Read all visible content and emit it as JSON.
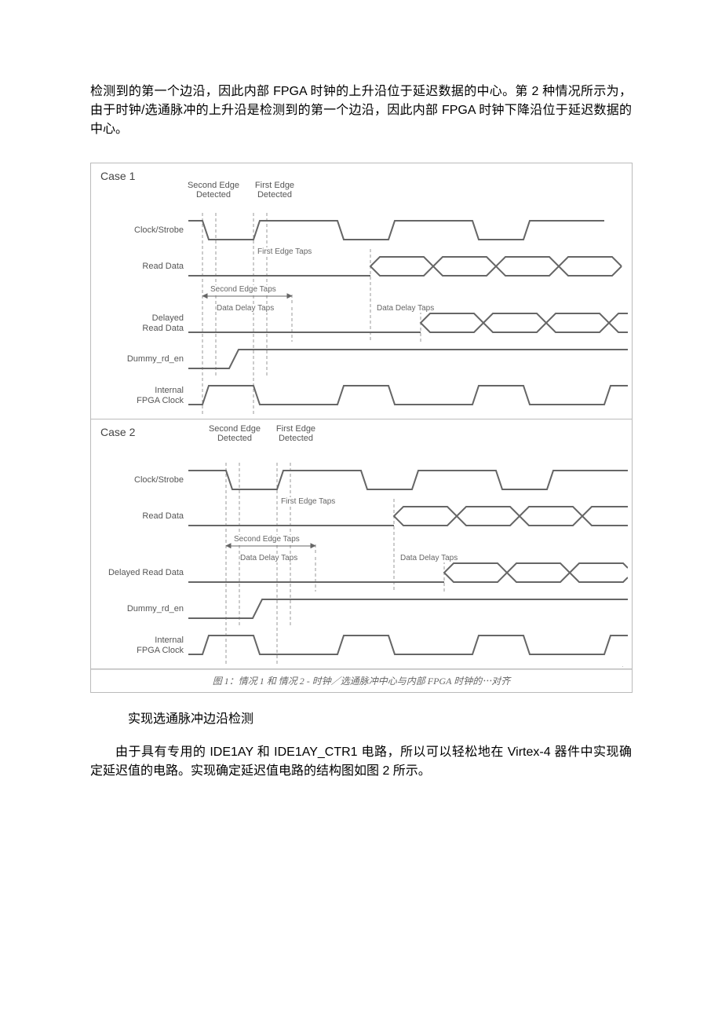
{
  "para_top": "检测到的第一个边沿，因此内部 FPGA 时钟的上升沿位于延迟数据的中心。第 2 种情况所示为，由于时钟/选通脉冲的上升沿是检测到的第一个边沿，因此内部 FPGA 时钟下降沿位于延迟数据的中心。",
  "figure": {
    "case1": {
      "title": "Case 1",
      "second_edge": "Second Edge\nDetected",
      "first_edge": "First Edge\nDetected",
      "rows": {
        "clock_strobe": "Clock/Strobe",
        "read_data": "Read Data",
        "first_edge_taps": "First Edge\nTaps",
        "second_edge_taps": "Second Edge Taps",
        "delayed_read_data": "Delayed\nRead Data",
        "data_delay_taps": "Data Delay Taps",
        "data_delay_taps2": "Data Delay Taps",
        "dummy_rd_en": "Dummy_rd_en",
        "internal_fpga_clock": "Internal\nFPGA Clock"
      }
    },
    "case2": {
      "title": "Case 2",
      "second_edge": "Second Edge\nDetected",
      "first_edge": "First Edge\nDetected",
      "rows": {
        "clock_strobe": "Clock/Strobe",
        "read_data": "Read Data",
        "first_edge_taps": "First Edge\nTaps",
        "second_edge_taps": "Second Edge Taps",
        "delayed_read_data": "Delayed Read Data",
        "data_delay_taps": "Data Delay Taps",
        "data_delay_taps2": "Data Delay Taps",
        "dummy_rd_en": "Dummy_rd_en",
        "internal_fpga_clock": "Internal\nFPGA Clock"
      }
    },
    "caption": "图 1：情况 1 和 情况 2 - 时钟／选通脉冲中心与内部 FPGA 时钟的⋯对齐"
  },
  "subtitle": "实现选通脉冲边沿检测",
  "para_bottom": "由于具有专用的 IDE1AY 和 IDE1AY_CTR1 电路，所以可以轻松地在 Virtex-4 器件中实现确定延迟值的电路。实现确定延迟值电路的结构图如图 2 所示。",
  "chart_data": {
    "type": "timing-diagram",
    "cases": [
      {
        "name": "Case 1",
        "edge_markers": [
          "Second Edge Detected",
          "First Edge Detected"
        ],
        "tap_markers": [
          "First Edge Taps",
          "Second Edge Taps",
          "Data Delay Taps"
        ],
        "signals": [
          {
            "name": "Clock/Strobe",
            "kind": "clock"
          },
          {
            "name": "Read Data",
            "kind": "data"
          },
          {
            "name": "Delayed Read Data",
            "kind": "data-delayed"
          },
          {
            "name": "Dummy_rd_en",
            "kind": "enable"
          },
          {
            "name": "Internal FPGA Clock",
            "kind": "clock"
          }
        ]
      },
      {
        "name": "Case 2",
        "edge_markers": [
          "Second Edge Detected",
          "First Edge Detected"
        ],
        "tap_markers": [
          "First Edge Taps",
          "Second Edge Taps",
          "Data Delay Taps"
        ],
        "signals": [
          {
            "name": "Clock/Strobe",
            "kind": "clock"
          },
          {
            "name": "Read Data",
            "kind": "data"
          },
          {
            "name": "Delayed Read Data",
            "kind": "data-delayed"
          },
          {
            "name": "Dummy_rd_en",
            "kind": "enable"
          },
          {
            "name": "Internal FPGA Clock",
            "kind": "clock"
          }
        ]
      }
    ]
  }
}
